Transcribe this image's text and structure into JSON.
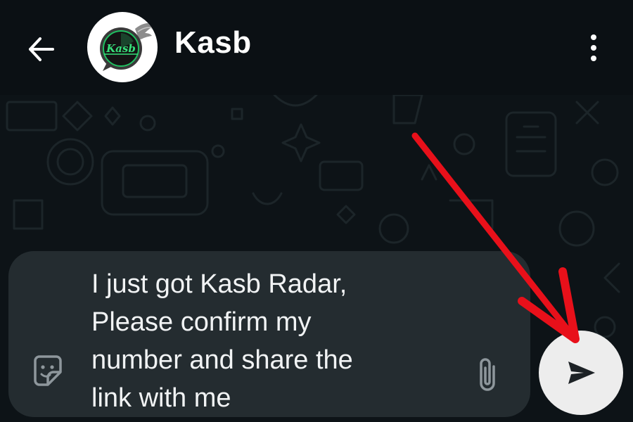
{
  "header": {
    "title": "Kasb",
    "avatar_text": "Kasb",
    "back_icon": "arrow-left-icon",
    "menu_icon": "more-vert-icon"
  },
  "composer": {
    "message_lines": [
      "I just got Kasb Radar,",
      "Please confirm my",
      "number and share the",
      "link with me"
    ],
    "sticker_icon": "sticker-icon",
    "attach_icon": "paperclip-icon",
    "send_icon": "send-icon"
  },
  "annotation": {
    "type": "red-arrow",
    "points_to": "send-button",
    "color": "#e8101a"
  },
  "colors": {
    "background": "#0b1014",
    "composer": "#242c30",
    "send_button": "#ededed",
    "text": "#ffffff"
  }
}
